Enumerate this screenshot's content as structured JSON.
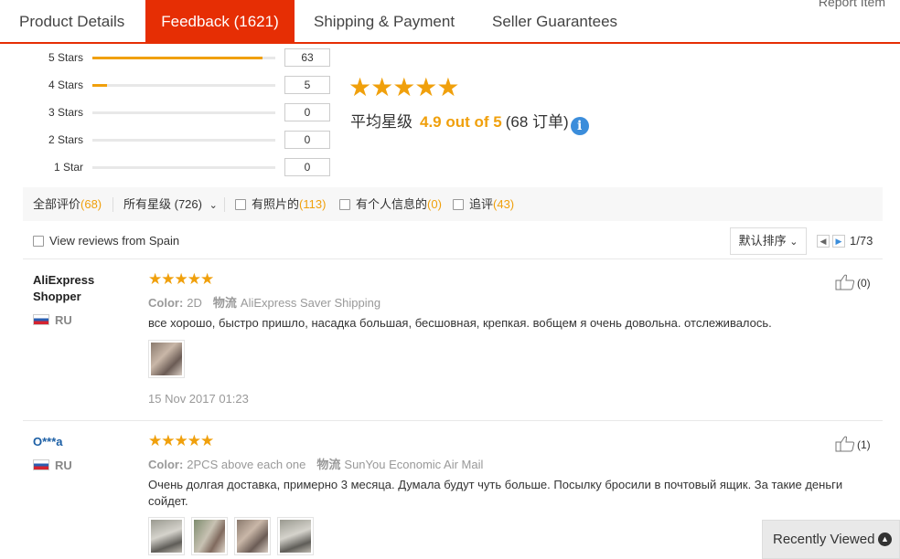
{
  "tabs": [
    {
      "label": "Product Details"
    },
    {
      "label": "Feedback (1621)"
    },
    {
      "label": "Shipping & Payment"
    },
    {
      "label": "Seller Guarantees"
    }
  ],
  "report_item": "Report Item",
  "histogram": [
    {
      "label": "5 Stars",
      "count": "63",
      "fill": 0.93
    },
    {
      "label": "4 Stars",
      "count": "5",
      "fill": 0.08
    },
    {
      "label": "3 Stars",
      "count": "0",
      "fill": 0
    },
    {
      "label": "2 Stars",
      "count": "0",
      "fill": 0
    },
    {
      "label": "1 Star",
      "count": "0",
      "fill": 0
    }
  ],
  "summary": {
    "stars": "★★★★★",
    "avg_label": "平均星级",
    "avg_score": "4.9 out of 5",
    "orders": "(68 订单)",
    "info_glyph": "i"
  },
  "filters": {
    "all_label": "全部评价",
    "all_count": "(68)",
    "stars_label": "所有星级 (726)",
    "chevron": "⌄",
    "photos_label": "有照片的",
    "photos_count": "(113)",
    "personal_label": "有个人信息的",
    "personal_count": "(0)",
    "followup_label": "追评",
    "followup_count": "(43)"
  },
  "spain_label": "View reviews from Spain",
  "sort_label": "默认排序",
  "sort_chevron": "⌄",
  "pager": {
    "prev": "◀",
    "next": "▶",
    "text": "1/73"
  },
  "reviews": [
    {
      "user": "AliExpress Shopper",
      "country": "RU",
      "stars": "★★★★★",
      "color_label": "Color:",
      "color_value": "2D",
      "ship_label": "物流",
      "ship_value": "AliExpress Saver Shipping",
      "text": "все хорошо, быстро пришло, насадка большая, бесшовная, крепкая. вобщем я очень довольна. отслеживалось.",
      "date": "15 Nov 2017 01:23",
      "likes": "(0)"
    },
    {
      "user": "O***a",
      "country": "RU",
      "stars": "★★★★★",
      "color_label": "Color:",
      "color_value": "2PCS above each one",
      "ship_label": "物流",
      "ship_value": "SunYou Economic Air Mail",
      "text": "Очень долгая доставка, примерно 3 месяца. Думала будут чуть больше. Посылку бросили в почтовый ящик. За такие деньги сойдет.",
      "likes": "(1)"
    }
  ],
  "recently_viewed": "Recently Viewed",
  "recently_glyph": "▲"
}
